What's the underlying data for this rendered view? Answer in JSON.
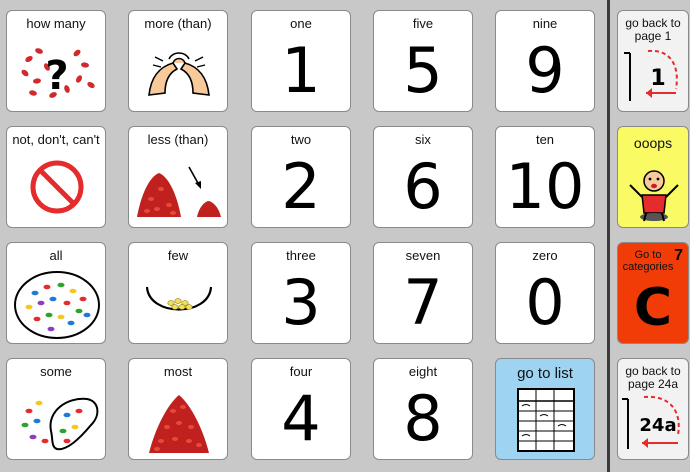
{
  "grid": {
    "col1": [
      {
        "label": "how many",
        "icon": "how-many-icon"
      },
      {
        "label": "not, don't, can't",
        "icon": "prohibited-icon"
      },
      {
        "label": "all",
        "icon": "all-beans-icon"
      },
      {
        "label": "some",
        "icon": "some-beans-icon"
      }
    ],
    "col2": [
      {
        "label": "more (than)",
        "icon": "more-hands-icon"
      },
      {
        "label": "less (than)",
        "icon": "less-beans-icon"
      },
      {
        "label": "few",
        "icon": "few-bowl-icon"
      },
      {
        "label": "most",
        "icon": "most-beans-icon"
      }
    ],
    "col3": [
      {
        "label": "one",
        "number": "1"
      },
      {
        "label": "two",
        "number": "2"
      },
      {
        "label": "three",
        "number": "3"
      },
      {
        "label": "four",
        "number": "4"
      }
    ],
    "col4": [
      {
        "label": "five",
        "number": "5"
      },
      {
        "label": "six",
        "number": "6"
      },
      {
        "label": "seven",
        "number": "7"
      },
      {
        "label": "eight",
        "number": "8"
      }
    ],
    "col5": [
      {
        "label": "nine",
        "number": "9"
      },
      {
        "label": "ten",
        "number": "10"
      },
      {
        "label": "zero",
        "number": "0"
      },
      {
        "label": "go to list",
        "icon": "table-list-icon"
      }
    ]
  },
  "sidebar": {
    "back_page1": {
      "label": "go back to page 1",
      "page": "1"
    },
    "ooops": {
      "label": "ooops",
      "color": "#fafa64"
    },
    "categories": {
      "label": "Go to categories",
      "number": "7",
      "letter": "C",
      "color": "#f23c08"
    },
    "back_page24a": {
      "label": "go back to page 24a",
      "page": "24a"
    }
  },
  "colors": {
    "background": "#c8c8c8",
    "list_button": "#9ed4f1",
    "divider": "#3a3a3a",
    "bean_red": "#d12a2a"
  }
}
